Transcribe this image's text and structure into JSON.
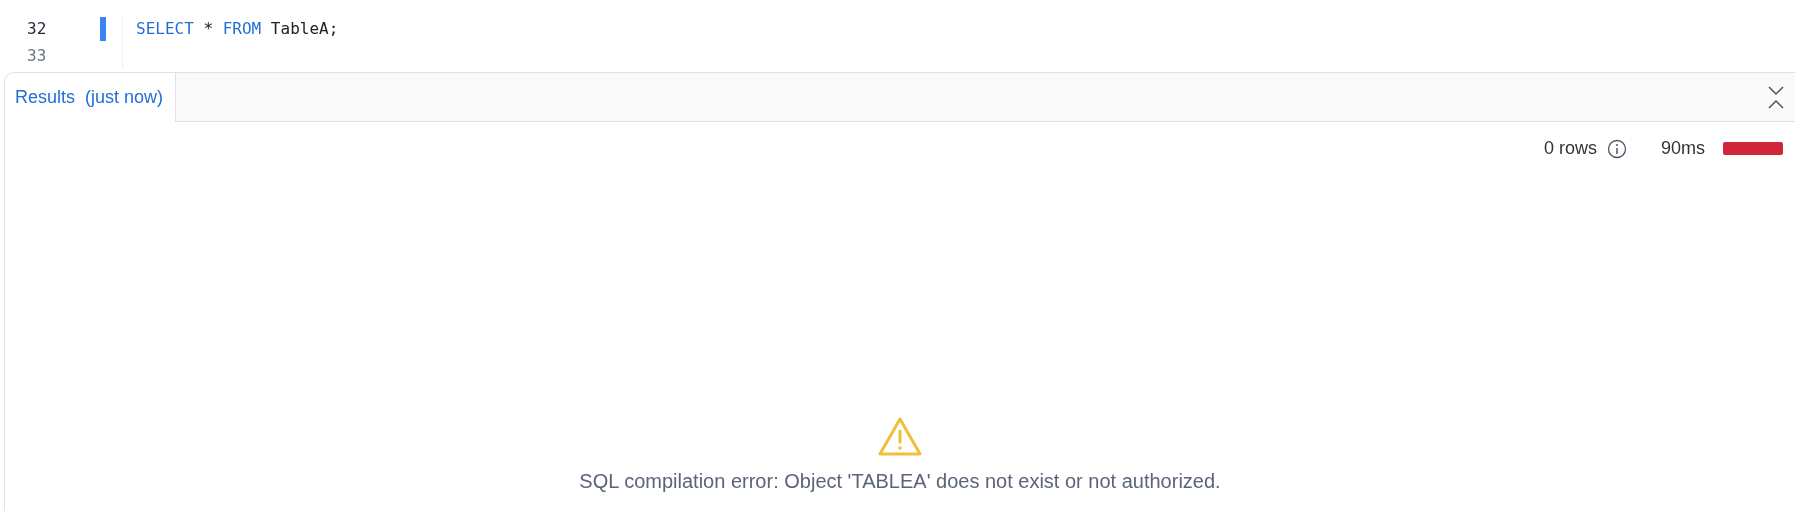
{
  "editor": {
    "lines": [
      {
        "number": "32",
        "active": true,
        "tokens": [
          {
            "kind": "keyword",
            "text": "SELECT"
          },
          {
            "kind": "plain",
            "text": " * "
          },
          {
            "kind": "keyword",
            "text": "FROM"
          },
          {
            "kind": "plain",
            "text": " TableA;"
          }
        ]
      },
      {
        "number": "33",
        "active": false
      }
    ]
  },
  "results": {
    "tabs": [
      {
        "label": "Results  (just now)",
        "selected": true
      }
    ],
    "row_count": "0 rows",
    "duration": "90ms",
    "error": "SQL compilation error: Object 'TABLEA' does not exist or not authorized."
  }
}
